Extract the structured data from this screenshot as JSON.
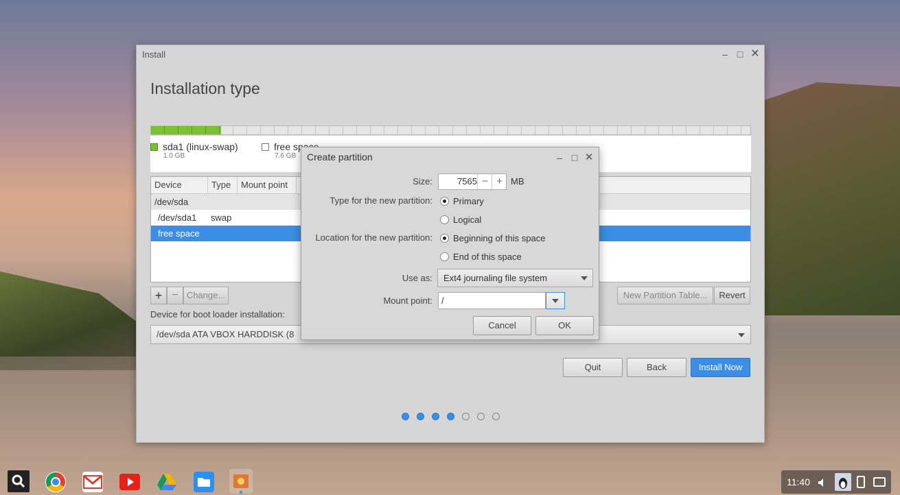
{
  "window": {
    "title": "Install",
    "heading": "Installation type"
  },
  "partitions_legend": [
    {
      "name": "sda1 (linux-swap)",
      "size": "1.0 GB",
      "color": "#7bc232"
    },
    {
      "name": "free space",
      "size": "7.6 GB",
      "color": "#ffffff"
    }
  ],
  "table": {
    "headers": [
      "Device",
      "Type",
      "Mount point",
      ""
    ],
    "rows": [
      {
        "device": "/dev/sda",
        "type": ""
      },
      {
        "device": "/dev/sda1",
        "type": "swap"
      },
      {
        "device": "free space",
        "type": ""
      }
    ]
  },
  "table_buttons": {
    "add": "+",
    "remove": "−",
    "change": "Change...",
    "new_table": "New Partition Table...",
    "revert": "Revert"
  },
  "bootloader": {
    "label": "Device for boot loader installation:",
    "value": "/dev/sda  ATA VBOX HARDDISK (8"
  },
  "nav_buttons": {
    "quit": "Quit",
    "back": "Back",
    "install": "Install Now"
  },
  "progress_steps": {
    "total": 7,
    "completed": 4
  },
  "dialog": {
    "title": "Create partition",
    "size_label": "Size:",
    "size_value": "7565",
    "size_unit": "MB",
    "type_label": "Type for the new partition:",
    "type_options": [
      "Primary",
      "Logical"
    ],
    "type_selected": "Primary",
    "location_label": "Location for the new partition:",
    "location_options": [
      "Beginning of this space",
      "End of this space"
    ],
    "location_selected": "Beginning of this space",
    "use_as_label": "Use as:",
    "use_as_value": "Ext4 journaling file system",
    "mount_label": "Mount point:",
    "mount_value": "/",
    "cancel": "Cancel",
    "ok": "OK"
  },
  "taskbar": {
    "apps": [
      "search-icon",
      "chrome-icon",
      "gmail-icon",
      "youtube-icon",
      "drive-icon",
      "files-icon",
      "installer-icon"
    ],
    "clock": "11:40"
  },
  "colors": {
    "accent": "#3b8ee3",
    "swap": "#7bc232"
  }
}
